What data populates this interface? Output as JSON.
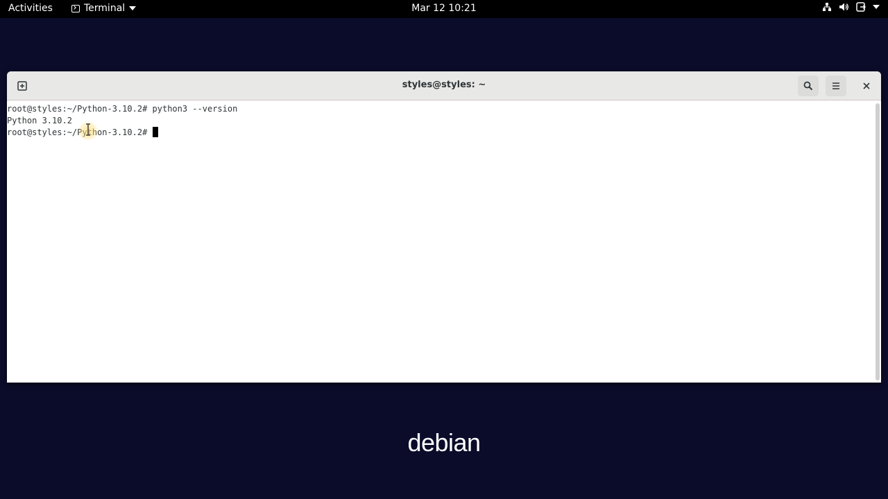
{
  "topbar": {
    "activities": "Activities",
    "app_name": "Terminal",
    "clock": "Mar 12  10:21"
  },
  "window": {
    "title": "styles@styles: ~"
  },
  "terminal": {
    "lines": [
      "root@styles:~/Python-3.10.2# python3 --version",
      "Python 3.10.2",
      "root@styles:~/Python-3.10.2# "
    ]
  },
  "desktop": {
    "logo_text": "debian"
  },
  "colors": {
    "topbar_bg": "#000000",
    "desktop_bg": "#0b0c2a",
    "titlebar_bg": "#e8e8e7",
    "logo_accent": "#d70751"
  }
}
